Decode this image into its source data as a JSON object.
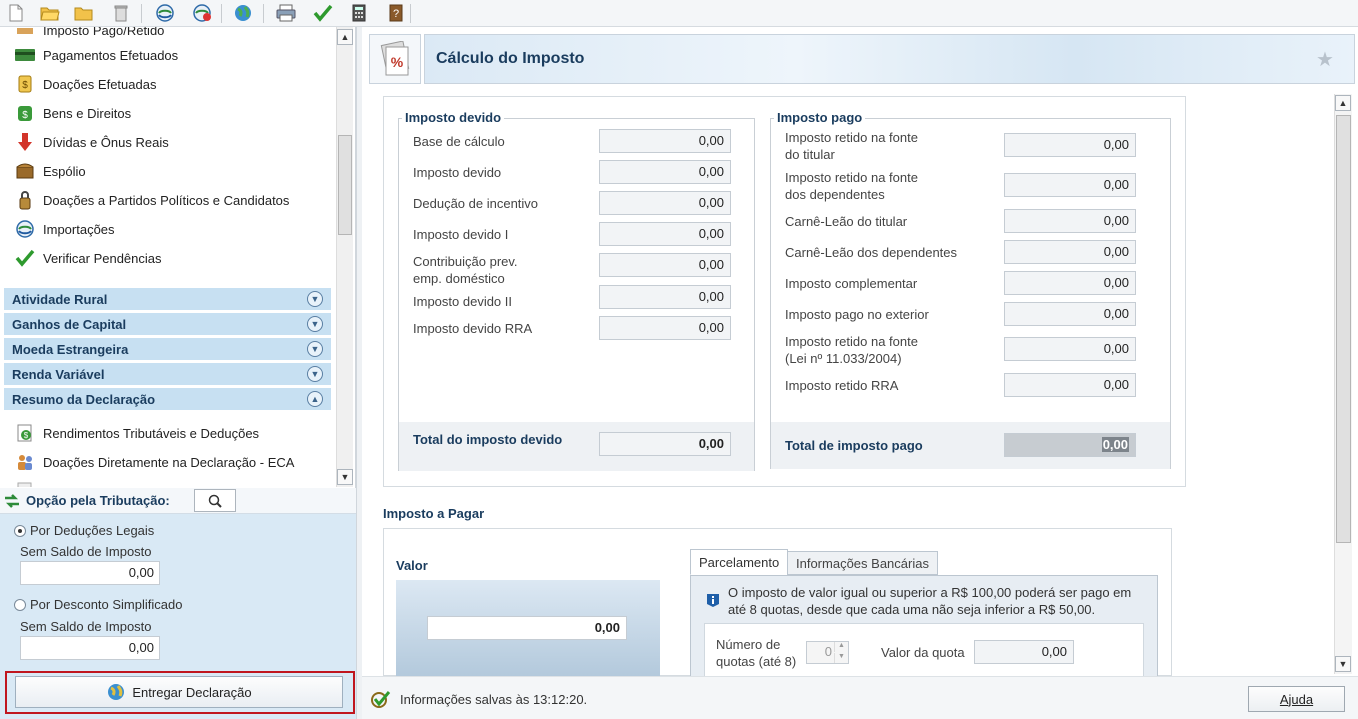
{
  "sidebar": {
    "partial_item": "Imposto Pago/Retido",
    "items": [
      {
        "label": "Pagamentos Efetuados",
        "icon": "card-icon"
      },
      {
        "label": "Doações Efetuadas",
        "icon": "coin-icon"
      },
      {
        "label": "Bens e Direitos",
        "icon": "money-bag-icon"
      },
      {
        "label": "Dívidas e Ônus Reais",
        "icon": "down-arrow-icon"
      },
      {
        "label": "Espólio",
        "icon": "chest-icon"
      },
      {
        "label": "Doações a Partidos Políticos e Candidatos",
        "icon": "padlock-bag-icon"
      },
      {
        "label": "Importações",
        "icon": "import-icon"
      },
      {
        "label": "Verificar Pendências",
        "icon": "checkmark-icon"
      }
    ],
    "sections": [
      {
        "label": "Atividade Rural",
        "expanded": false
      },
      {
        "label": "Ganhos de Capital",
        "expanded": false
      },
      {
        "label": "Moeda Estrangeira",
        "expanded": false
      },
      {
        "label": "Renda Variável",
        "expanded": false
      },
      {
        "label": "Resumo da Declaração",
        "expanded": true
      }
    ],
    "resumo_items": [
      {
        "label": "Rendimentos Tributáveis e Deduções",
        "icon": "money-doc-icon"
      },
      {
        "label": "Doações Diretamente na Declaração - ECA",
        "icon": "family-icon"
      }
    ]
  },
  "option_panel": {
    "title": "Opção pela Tributação:",
    "option1": {
      "label": "Por Deduções Legais",
      "sub": "Sem Saldo de Imposto",
      "value": "0,00",
      "selected": true
    },
    "option2": {
      "label": "Por Desconto Simplificado",
      "sub": "Sem Saldo de Imposto",
      "value": "0,00",
      "selected": false
    },
    "submit_label": "Entregar Declaração"
  },
  "main": {
    "title": "Cálculo do Imposto",
    "imposto_devido": {
      "title": "Imposto devido",
      "rows": [
        {
          "label": "Base de cálculo",
          "value": "0,00"
        },
        {
          "label": "Imposto devido",
          "value": "0,00"
        },
        {
          "label": "Dedução de incentivo",
          "value": "0,00"
        },
        {
          "label": "Imposto devido I",
          "value": "0,00"
        },
        {
          "label": "Contribuição prev. emp. doméstico",
          "value": "0,00"
        },
        {
          "label": "Imposto devido II",
          "value": "0,00"
        },
        {
          "label": "Imposto devido RRA",
          "value": "0,00"
        }
      ],
      "total_label": "Total do imposto devido",
      "total_value": "0,00"
    },
    "imposto_pago": {
      "title": "Imposto pago",
      "rows": [
        {
          "label": "Imposto retido na fonte do titular",
          "value": "0,00"
        },
        {
          "label": "Imposto retido na fonte dos dependentes",
          "value": "0,00"
        },
        {
          "label": "Carnê-Leão do titular",
          "value": "0,00"
        },
        {
          "label": "Carnê-Leão dos dependentes",
          "value": "0,00"
        },
        {
          "label": "Imposto complementar",
          "value": "0,00"
        },
        {
          "label": "Imposto pago no exterior",
          "value": "0,00"
        },
        {
          "label": "Imposto retido na fonte (Lei nº 11.033/2004)",
          "value": "0,00"
        },
        {
          "label": "Imposto retido RRA",
          "value": "0,00"
        }
      ],
      "total_label": "Total de imposto pago",
      "total_value": "0,00"
    },
    "a_pagar": {
      "title": "Imposto a Pagar",
      "valor_label": "Valor",
      "valor": "0,00",
      "tabs": [
        "Parcelamento",
        "Informações Bancárias"
      ],
      "info_text": "O imposto de valor igual ou superior a R$ 100,00 poderá ser pago em até 8 quotas, desde que cada uma não seja inferior a R$ 50,00.",
      "quotas_label": "Número de quotas (até 8)",
      "quotas_value": "0",
      "valor_quota_label": "Valor da quota",
      "valor_quota": "0,00"
    }
  },
  "status": {
    "text": "Informações salvas às 13:12:20.",
    "help_label": "Ajuda"
  }
}
